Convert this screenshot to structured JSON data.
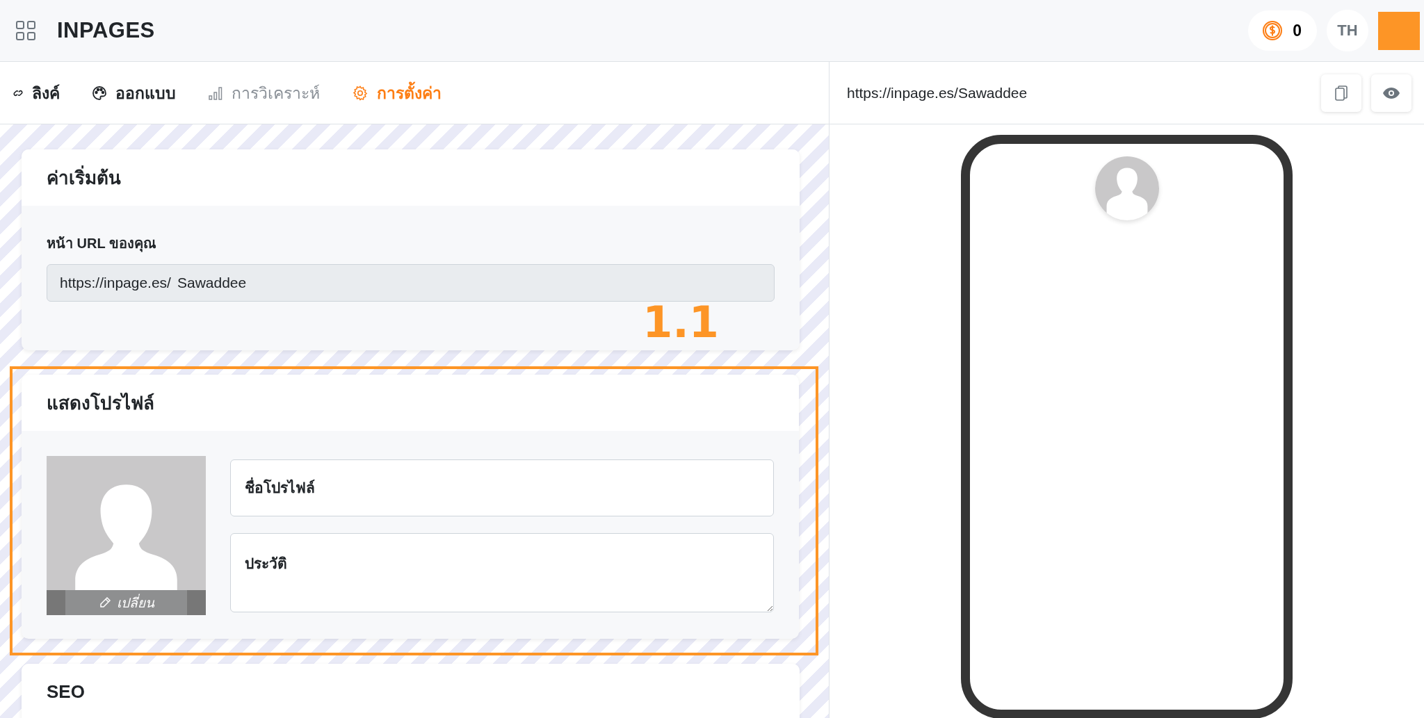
{
  "header": {
    "brand": "INPAGES",
    "coins": "0",
    "language": "TH"
  },
  "tabs": [
    {
      "label": "ลิงค์",
      "kind": "link",
      "selected": false,
      "disabled": false
    },
    {
      "label": "ออกแบบ",
      "kind": "design",
      "selected": false,
      "disabled": false
    },
    {
      "label": "การวิเคราะห์",
      "kind": "analytics",
      "selected": false,
      "disabled": true
    },
    {
      "label": "การตั้งค่า",
      "kind": "settings",
      "selected": true,
      "disabled": false
    }
  ],
  "defaults_card": {
    "title": "ค่าเริ่มต้น",
    "url_label": "หน้า URL ของคุณ",
    "url_prefix": "https://inpage.es/",
    "url_value": "Sawaddee",
    "annotation": "1.1"
  },
  "profile_card": {
    "title": "แสดงโปรไฟล์",
    "highlighted": true,
    "change_photo": "เปลี่ยน",
    "name_placeholder": "ชื่อโปรไฟล์",
    "bio_placeholder": "ประวัติ"
  },
  "seo_card": {
    "title": "SEO"
  },
  "preview": {
    "url": "https://inpage.es/Sawaddee"
  }
}
